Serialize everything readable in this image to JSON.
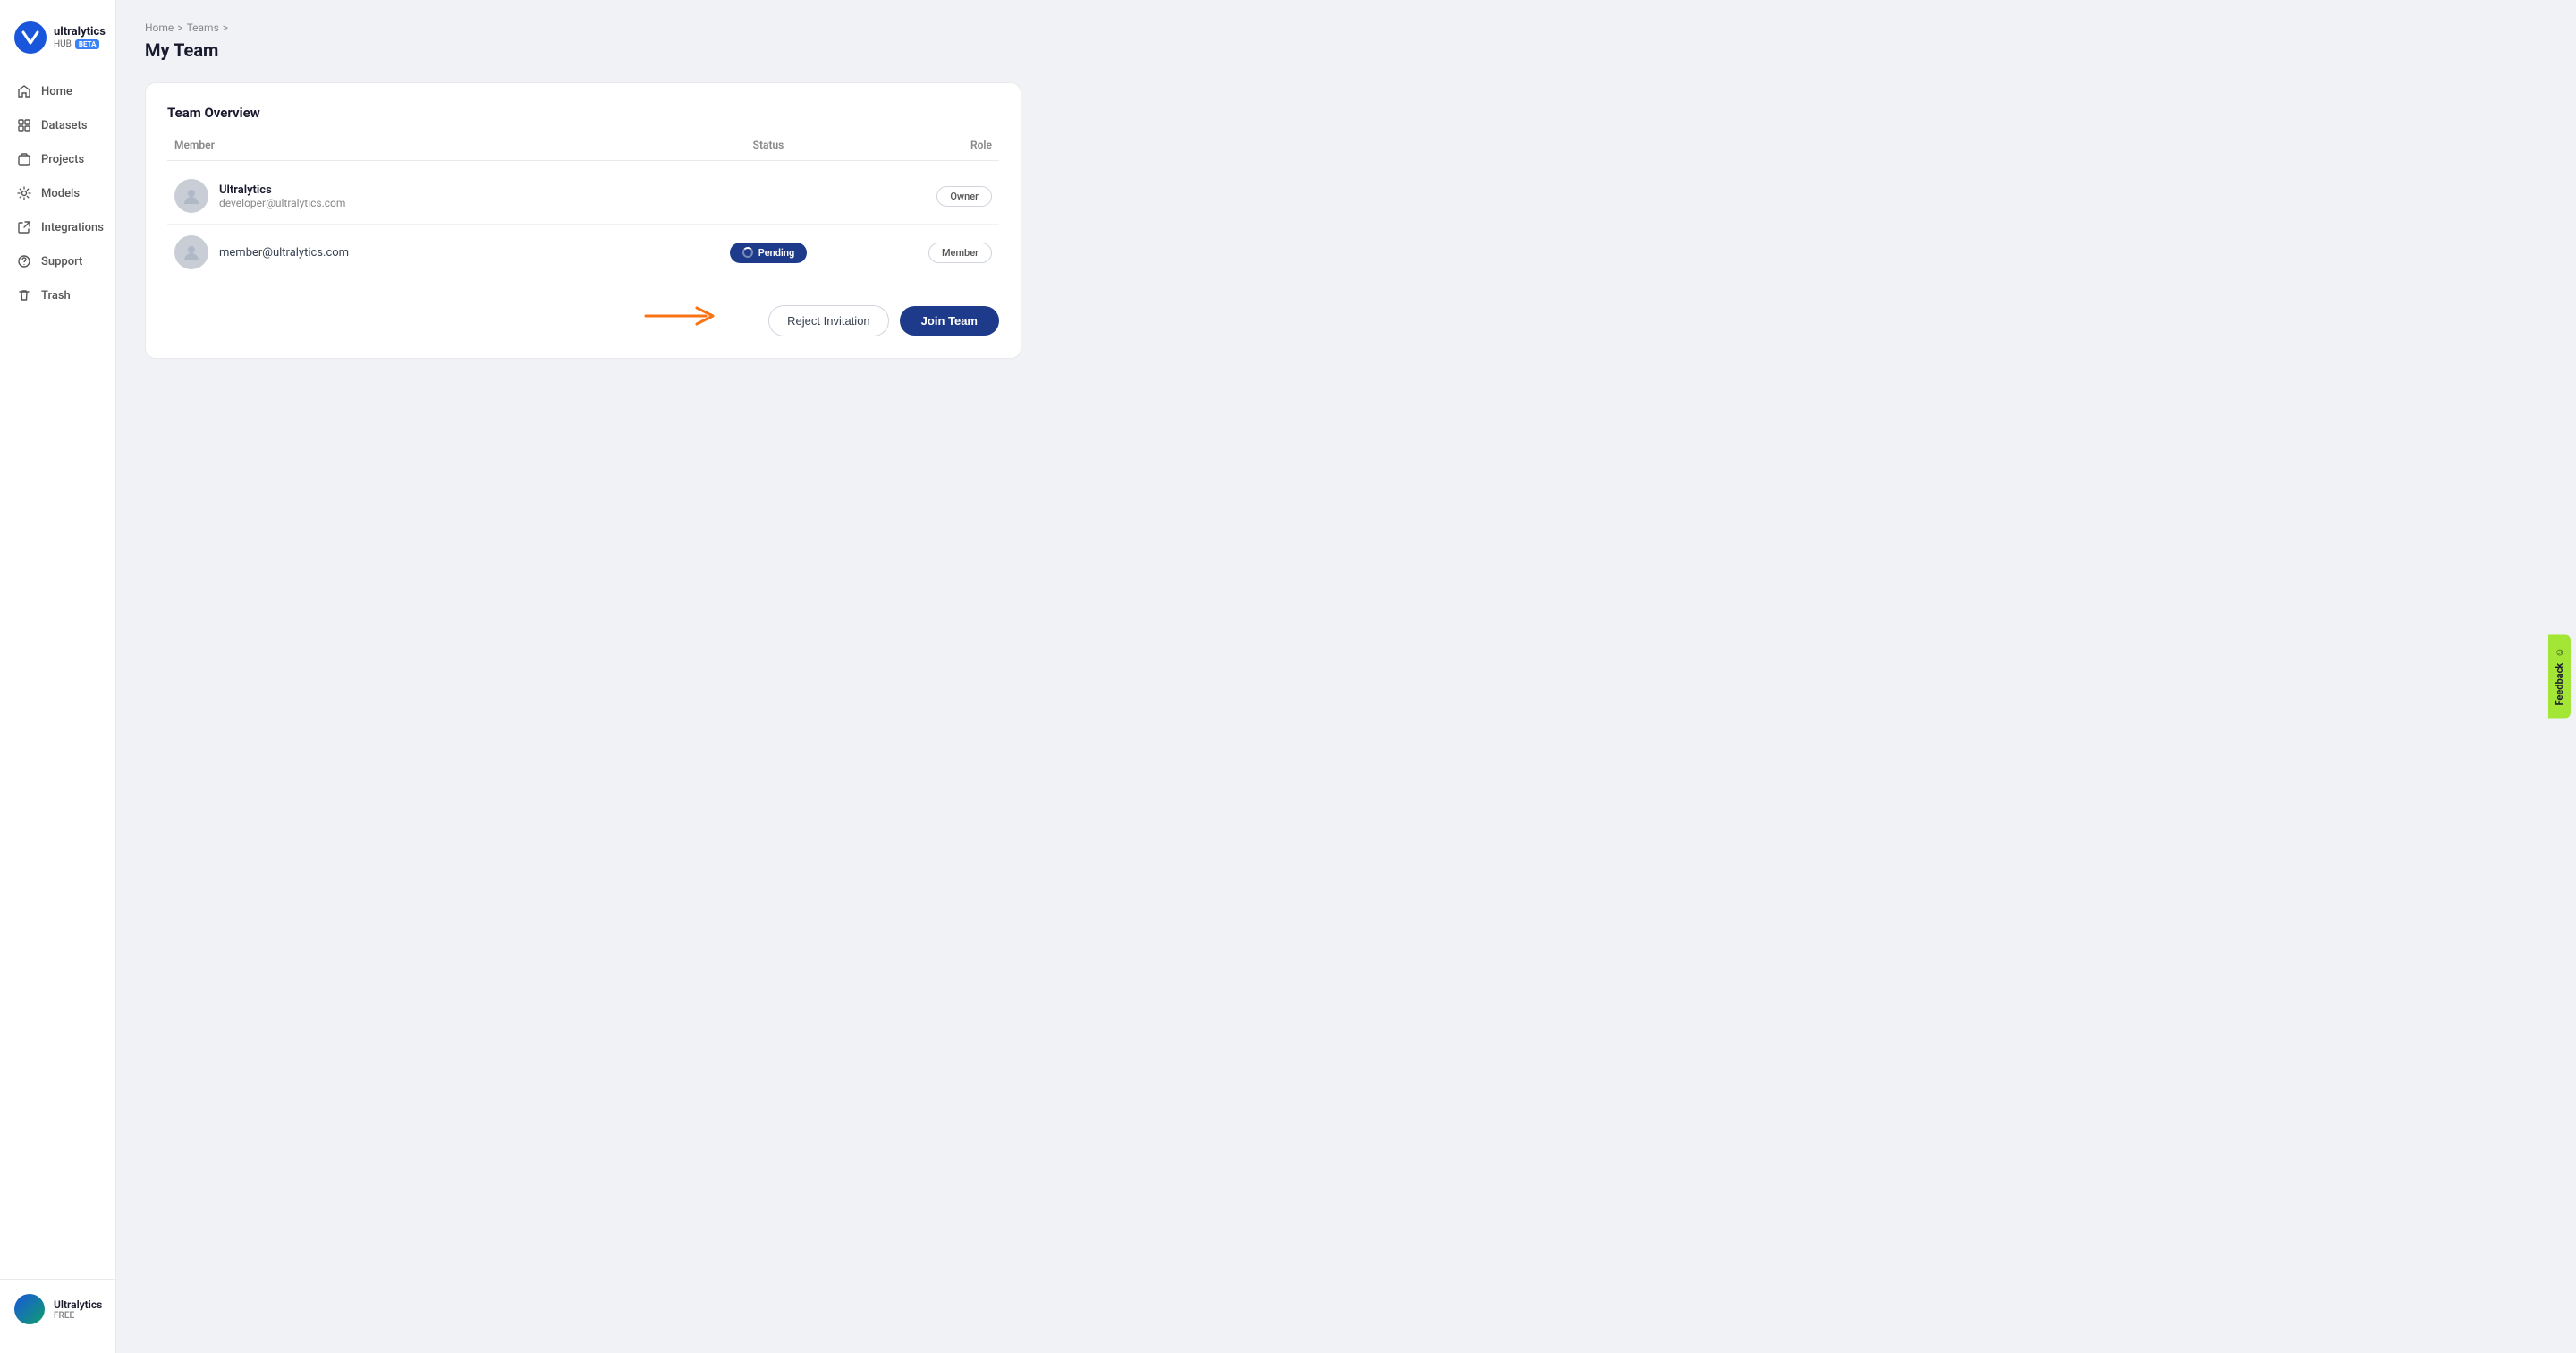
{
  "logo": {
    "name": "ultralytics",
    "hub": "HUB",
    "beta": "BETA"
  },
  "sidebar": {
    "items": [
      {
        "id": "home",
        "label": "Home",
        "icon": "home"
      },
      {
        "id": "datasets",
        "label": "Datasets",
        "icon": "datasets"
      },
      {
        "id": "projects",
        "label": "Projects",
        "icon": "projects"
      },
      {
        "id": "models",
        "label": "Models",
        "icon": "models"
      },
      {
        "id": "integrations",
        "label": "Integrations",
        "icon": "integrations"
      },
      {
        "id": "support",
        "label": "Support",
        "icon": "support"
      },
      {
        "id": "trash",
        "label": "Trash",
        "icon": "trash"
      }
    ]
  },
  "user": {
    "name": "Ultralytics",
    "plan": "FREE"
  },
  "breadcrumb": {
    "home": "Home",
    "teams": "Teams",
    "separator": ">"
  },
  "page": {
    "title": "My Team"
  },
  "team_card": {
    "title": "Team Overview",
    "table": {
      "headers": {
        "member": "Member",
        "status": "Status",
        "role": "Role"
      },
      "rows": [
        {
          "name": "Ultralytics",
          "email": "developer@ultralytics.com",
          "status": "",
          "role": "Owner"
        },
        {
          "name": "",
          "email": "member@ultralytics.com",
          "status": "Pending",
          "role": "Member"
        }
      ]
    },
    "actions": {
      "reject": "Reject Invitation",
      "join": "Join Team"
    }
  },
  "feedback": {
    "label": "Feedback"
  }
}
